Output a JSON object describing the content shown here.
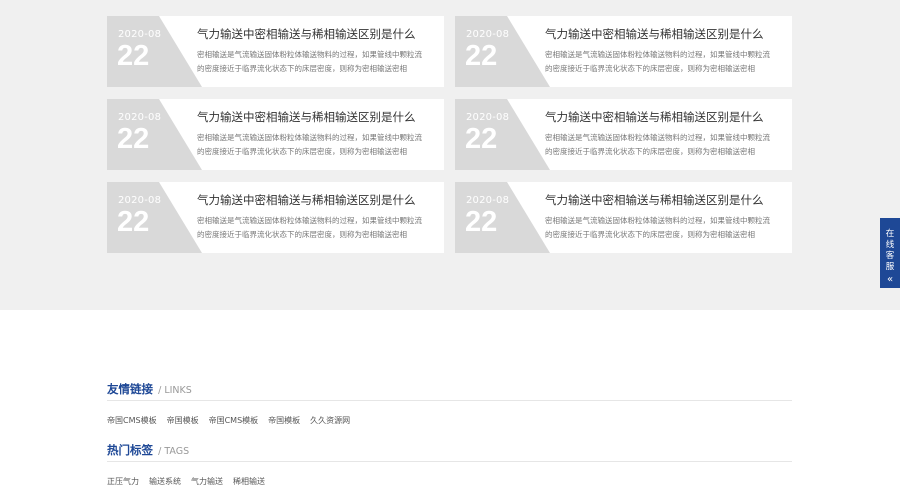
{
  "news": {
    "items": [
      {
        "date_ym": "2020-08",
        "date_day": "22",
        "title": "气力输送中密相输送与稀相输送区别是什么",
        "desc": "密相输送是气流输送固体粉粒体输送物料的过程，如果管线中颗粒流的密度接近于临界流化状态下的床层密度，则称为密相输送密相"
      },
      {
        "date_ym": "2020-08",
        "date_day": "22",
        "title": "气力输送中密相输送与稀相输送区别是什么",
        "desc": "密相输送是气流输送固体粉粒体输送物料的过程，如果管线中颗粒流的密度接近于临界流化状态下的床层密度，则称为密相输送密相"
      },
      {
        "date_ym": "2020-08",
        "date_day": "22",
        "title": "气力输送中密相输送与稀相输送区别是什么",
        "desc": "密相输送是气流输送固体粉粒体输送物料的过程，如果管线中颗粒流的密度接近于临界流化状态下的床层密度，则称为密相输送密相"
      },
      {
        "date_ym": "2020-08",
        "date_day": "22",
        "title": "气力输送中密相输送与稀相输送区别是什么",
        "desc": "密相输送是气流输送固体粉粒体输送物料的过程，如果管线中颗粒流的密度接近于临界流化状态下的床层密度，则称为密相输送密相"
      },
      {
        "date_ym": "2020-08",
        "date_day": "22",
        "title": "气力输送中密相输送与稀相输送区别是什么",
        "desc": "密相输送是气流输送固体粉粒体输送物料的过程，如果管线中颗粒流的密度接近于临界流化状态下的床层密度，则称为密相输送密相"
      },
      {
        "date_ym": "2020-08",
        "date_day": "22",
        "title": "气力输送中密相输送与稀相输送区别是什么",
        "desc": "密相输送是气流输送固体粉粒体输送物料的过程，如果管线中颗粒流的密度接近于临界流化状态下的床层密度，则称为密相输送密相"
      }
    ]
  },
  "links": {
    "title": "友情链接",
    "subtitle": "/ LINKS",
    "items": [
      "帝国CMS模板",
      "帝国模板",
      "帝国CMS模板",
      "帝国模板",
      "久久资源网"
    ]
  },
  "tags": {
    "title": "热门标签",
    "subtitle": "/ TAGS",
    "items": [
      "正压气力",
      "输送系统",
      "气力输送",
      "稀相输送"
    ]
  },
  "kefu": {
    "label": "在线客服",
    "icon": "double-chevron-left-icon",
    "glyph": "«"
  },
  "colors": {
    "accent": "#1e4896",
    "section_bg": "#f0f0f0",
    "date_block": "#d9d9d9"
  }
}
